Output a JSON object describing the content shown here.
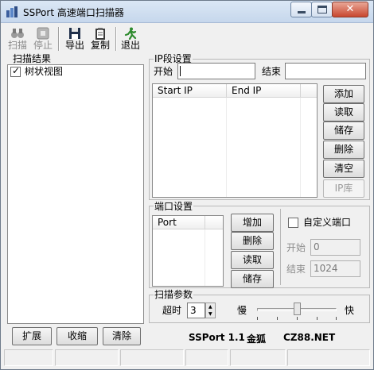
{
  "window": {
    "title": "SSPort 高速端口扫描器"
  },
  "toolbar": {
    "scan": "扫描",
    "stop": "停止",
    "export": "导出",
    "copy": "复制",
    "exit": "退出"
  },
  "results": {
    "group_label": "扫描结果",
    "tree_view_label": "树状视图",
    "tree_view_checked": true,
    "expand_button": "扩展",
    "collapse_button": "收缩",
    "clear_button": "清除"
  },
  "ip_settings": {
    "group_label": "IP段设置",
    "start_label": "开始",
    "start_value": "",
    "end_label": "结束",
    "end_value": "",
    "columns": [
      "Start IP",
      "End IP"
    ],
    "add_button": "添加",
    "read_button": "读取",
    "save_button": "储存",
    "delete_button": "删除",
    "clear_button": "清空",
    "iplib_button": "IP库"
  },
  "port_settings": {
    "group_label": "端口设置",
    "columns": [
      "Port"
    ],
    "add_button": "增加",
    "delete_button": "删除",
    "read_button": "读取",
    "save_button": "储存",
    "custom_port_label": "自定义端口",
    "custom_port_checked": false,
    "start_label": "开始",
    "start_value": "0",
    "end_label": "结束",
    "end_value": "1024"
  },
  "scan_params": {
    "group_label": "扫描参数",
    "timeout_label": "超时",
    "timeout_value": "3",
    "slow_label": "慢",
    "fast_label": "快",
    "speed_level": 0.5
  },
  "footer": {
    "product": "SSPort 1.1",
    "author": "金狐",
    "site": "CZ88.NET"
  }
}
